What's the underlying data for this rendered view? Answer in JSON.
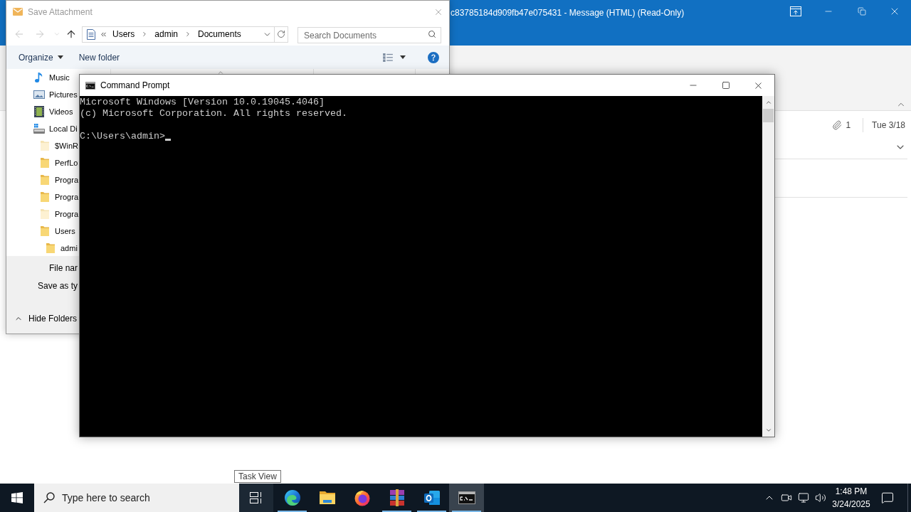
{
  "outlook_window": {
    "title": "c83785184d909fb47e075431 - Message (HTML) (Read-Only)",
    "message": {
      "attachment_count": "1",
      "date": "Tue 3/18"
    }
  },
  "save_dialog": {
    "title": "Save Attachment",
    "navigation": [
      {
        "kind": "back",
        "disabled": true
      },
      {
        "kind": "forward",
        "disabled": true
      },
      {
        "kind": "recent",
        "disabled": true
      },
      {
        "kind": "up",
        "disabled": false
      }
    ],
    "path": [
      "Users",
      "admin",
      "Documents"
    ],
    "search": {
      "placeholder": "Search Documents"
    },
    "toolbar": [
      {
        "label": "Organize",
        "kind": "menu"
      },
      {
        "label": "New folder",
        "kind": "button"
      }
    ],
    "tree": [
      {
        "kind": "music",
        "label": "Music",
        "hidden": false
      },
      {
        "kind": "pictures",
        "label": "Pictures",
        "hidden": false
      },
      {
        "kind": "videos",
        "label": "Videos",
        "hidden": false
      },
      {
        "kind": "drive",
        "label": "Local Di",
        "hidden": false,
        "children": [
          {
            "kind": "folder",
            "label": "$WinR",
            "hidden": true
          },
          {
            "kind": "folder",
            "label": "PerfLo",
            "hidden": false
          },
          {
            "kind": "folder",
            "label": "Progra",
            "hidden": false
          },
          {
            "kind": "folder",
            "label": "Progra",
            "hidden": false
          },
          {
            "kind": "folder",
            "label": "Progra",
            "hidden": true
          },
          {
            "kind": "folder",
            "label": "Users",
            "hidden": false,
            "children": [
              {
                "kind": "folder",
                "label": "admi",
                "hidden": false
              }
            ]
          }
        ]
      }
    ],
    "fields": [
      {
        "label": "File nar"
      },
      {
        "label": "Save as ty"
      }
    ],
    "hide_folders": "Hide Folders"
  },
  "command_prompt": {
    "title": "Command Prompt",
    "output": [
      "Microsoft Windows [Version 10.0.19045.4046]",
      "(c) Microsoft Corporation. All rights reserved."
    ],
    "prompt": "C:\\Users\\admin>"
  },
  "taskbar": {
    "search": {
      "placeholder": "Type here to search"
    },
    "tooltip": "Task View",
    "apps": [
      {
        "kind": "edge",
        "running": true,
        "active": false
      },
      {
        "kind": "explorer",
        "running": false,
        "active": false
      },
      {
        "kind": "firefox",
        "running": false,
        "active": false
      },
      {
        "kind": "winrar",
        "running": true,
        "active": false
      },
      {
        "kind": "outlook",
        "running": true,
        "active": false
      },
      {
        "kind": "cmd",
        "running": true,
        "active": true
      }
    ],
    "clock": {
      "time": "1:48 PM",
      "date": "3/24/2025"
    }
  }
}
